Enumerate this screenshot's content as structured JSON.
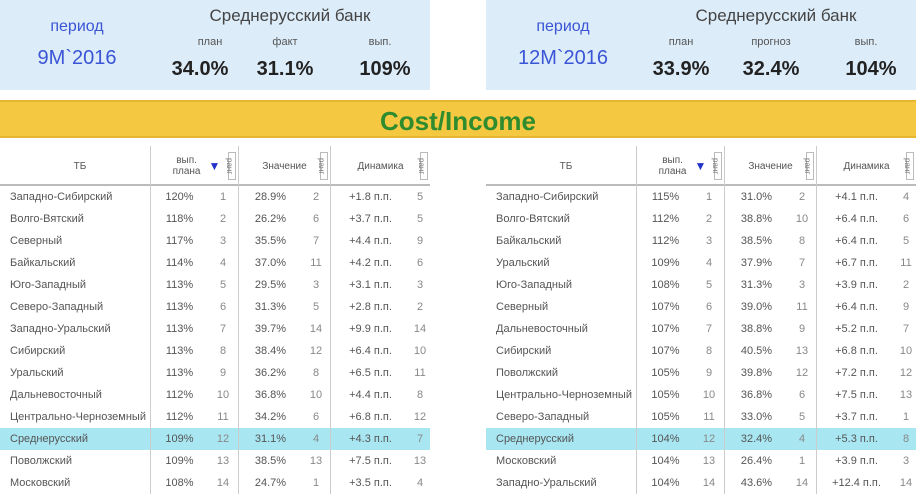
{
  "kpi_left": {
    "period_label": "период",
    "period_value": "9М`2016",
    "bank_name": "Среднерусский банк",
    "cap1": "план",
    "cap2": "факт",
    "cap3": "вып.",
    "val1": "34.0%",
    "val2": "31.1%",
    "val3": "109%"
  },
  "kpi_right": {
    "period_label": "период",
    "period_value": "12М`2016",
    "bank_name": "Среднерусский банк",
    "cap1": "план",
    "cap2": "прогноз",
    "cap3": "вып.",
    "val1": "33.9%",
    "val2": "32.4%",
    "val3": "104%"
  },
  "banner": {
    "title": "Cost/Income"
  },
  "headers": {
    "tb": "ТБ",
    "completion": "вып. плана",
    "value": "Значение",
    "dynamics": "Динамика",
    "rank": "ранг",
    "sort_icon": "sort-down-triangle"
  },
  "colors": {
    "banner": "#f5c842",
    "banner_text": "#2e8b2e",
    "highlight": "#a8e6f2",
    "kpi_bg": "#dcecf8",
    "period_text": "#3a55d6"
  },
  "rows_left": [
    {
      "tb": "Западно-Сибирский",
      "pct": "120%",
      "r1": "1",
      "zn": "28.9%",
      "r2": "2",
      "dn": "+1.8 п.п.",
      "r3": "5"
    },
    {
      "tb": "Волго-Вятский",
      "pct": "118%",
      "r1": "2",
      "zn": "26.2%",
      "r2": "6",
      "dn": "+3.7 п.п.",
      "r3": "5"
    },
    {
      "tb": "Северный",
      "pct": "117%",
      "r1": "3",
      "zn": "35.5%",
      "r2": "7",
      "dn": "+4.4 п.п.",
      "r3": "9"
    },
    {
      "tb": "Байкальский",
      "pct": "114%",
      "r1": "4",
      "zn": "37.0%",
      "r2": "11",
      "dn": "+4.2 п.п.",
      "r3": "6"
    },
    {
      "tb": "Юго-Западный",
      "pct": "113%",
      "r1": "5",
      "zn": "29.5%",
      "r2": "3",
      "dn": "+3.1 п.п.",
      "r3": "3"
    },
    {
      "tb": "Северо-Западный",
      "pct": "113%",
      "r1": "6",
      "zn": "31.3%",
      "r2": "5",
      "dn": "+2.8 п.п.",
      "r3": "2"
    },
    {
      "tb": "Западно-Уральский",
      "pct": "113%",
      "r1": "7",
      "zn": "39.7%",
      "r2": "14",
      "dn": "+9.9 п.п.",
      "r3": "14"
    },
    {
      "tb": "Сибирский",
      "pct": "113%",
      "r1": "8",
      "zn": "38.4%",
      "r2": "12",
      "dn": "+6.4 п.п.",
      "r3": "10"
    },
    {
      "tb": "Уральский",
      "pct": "113%",
      "r1": "9",
      "zn": "36.2%",
      "r2": "8",
      "dn": "+6.5 п.п.",
      "r3": "11"
    },
    {
      "tb": "Дальневосточный",
      "pct": "112%",
      "r1": "10",
      "zn": "36.8%",
      "r2": "10",
      "dn": "+4.4 п.п.",
      "r3": "8"
    },
    {
      "tb": "Центрально-Черноземный",
      "pct": "112%",
      "r1": "11",
      "zn": "34.2%",
      "r2": "6",
      "dn": "+6.8 п.п.",
      "r3": "12"
    },
    {
      "tb": "Среднерусский",
      "pct": "109%",
      "r1": "12",
      "zn": "31.1%",
      "r2": "4",
      "dn": "+4.3 п.п.",
      "r3": "7",
      "hl": true
    },
    {
      "tb": "Поволжский",
      "pct": "109%",
      "r1": "13",
      "zn": "38.5%",
      "r2": "13",
      "dn": "+7.5 п.п.",
      "r3": "13"
    },
    {
      "tb": "Московский",
      "pct": "108%",
      "r1": "14",
      "zn": "24.7%",
      "r2": "1",
      "dn": "+3.5 п.п.",
      "r3": "4"
    }
  ],
  "rows_right": [
    {
      "tb": "Западно-Сибирский",
      "pct": "115%",
      "r1": "1",
      "zn": "31.0%",
      "r2": "2",
      "dn": "+4.1 п.п.",
      "r3": "4"
    },
    {
      "tb": "Волго-Вятский",
      "pct": "112%",
      "r1": "2",
      "zn": "38.8%",
      "r2": "10",
      "dn": "+6.4 п.п.",
      "r3": "6"
    },
    {
      "tb": "Байкальский",
      "pct": "112%",
      "r1": "3",
      "zn": "38.5%",
      "r2": "8",
      "dn": "+6.4 п.п.",
      "r3": "5"
    },
    {
      "tb": "Уральский",
      "pct": "109%",
      "r1": "4",
      "zn": "37.9%",
      "r2": "7",
      "dn": "+6.7 п.п.",
      "r3": "11"
    },
    {
      "tb": "Юго-Западный",
      "pct": "108%",
      "r1": "5",
      "zn": "31.3%",
      "r2": "3",
      "dn": "+3.9 п.п.",
      "r3": "2"
    },
    {
      "tb": "Северный",
      "pct": "107%",
      "r1": "6",
      "zn": "39.0%",
      "r2": "11",
      "dn": "+6.4 п.п.",
      "r3": "9"
    },
    {
      "tb": "Дальневосточный",
      "pct": "107%",
      "r1": "7",
      "zn": "38.8%",
      "r2": "9",
      "dn": "+5.2 п.п.",
      "r3": "7"
    },
    {
      "tb": "Сибирский",
      "pct": "107%",
      "r1": "8",
      "zn": "40.5%",
      "r2": "13",
      "dn": "+6.8 п.п.",
      "r3": "10"
    },
    {
      "tb": "Поволжский",
      "pct": "105%",
      "r1": "9",
      "zn": "39.8%",
      "r2": "12",
      "dn": "+7.2 п.п.",
      "r3": "12"
    },
    {
      "tb": "Центрально-Черноземный",
      "pct": "105%",
      "r1": "10",
      "zn": "36.8%",
      "r2": "6",
      "dn": "+7.5 п.п.",
      "r3": "13"
    },
    {
      "tb": "Северо-Западный",
      "pct": "105%",
      "r1": "11",
      "zn": "33.0%",
      "r2": "5",
      "dn": "+3.7 п.п.",
      "r3": "1"
    },
    {
      "tb": "Среднерусский",
      "pct": "104%",
      "r1": "12",
      "zn": "32.4%",
      "r2": "4",
      "dn": "+5.3 п.п.",
      "r3": "8",
      "hl": true
    },
    {
      "tb": "Московский",
      "pct": "104%",
      "r1": "13",
      "zn": "26.4%",
      "r2": "1",
      "dn": "+3.9 п.п.",
      "r3": "3"
    },
    {
      "tb": "Западно-Уральский",
      "pct": "104%",
      "r1": "14",
      "zn": "43.6%",
      "r2": "14",
      "dn": "+12.4 п.п.",
      "r3": "14"
    }
  ]
}
